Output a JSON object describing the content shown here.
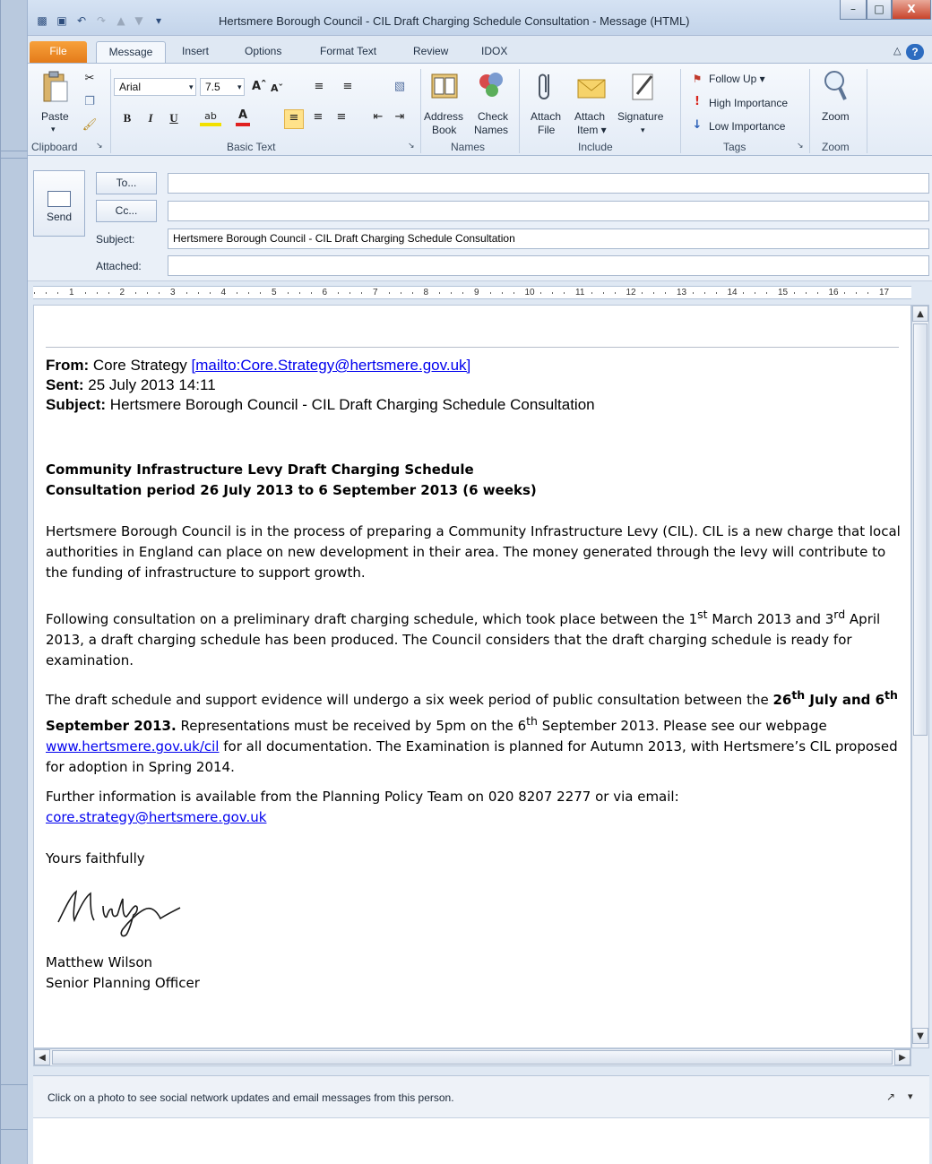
{
  "window": {
    "title": "Hertsmere Borough Council - CIL Draft Charging Schedule Consultation - Message (HTML)",
    "minimize": "–",
    "maximize": "□",
    "close": "X"
  },
  "tabs": [
    "File",
    "Message",
    "Insert",
    "Options",
    "Format Text",
    "Review",
    "IDOX"
  ],
  "ribbon": {
    "clipboard": {
      "paste": "Paste",
      "label": "Clipboard"
    },
    "basic_text": {
      "font": "Arial",
      "size": "7.5",
      "bold": "B",
      "italic": "I",
      "underline": "U",
      "label": "Basic Text"
    },
    "names": {
      "address_book_1": "Address",
      "address_book_2": "Book",
      "check_names_1": "Check",
      "check_names_2": "Names",
      "label": "Names"
    },
    "include": {
      "attach_file_1": "Attach",
      "attach_file_2": "File",
      "attach_item_1": "Attach",
      "attach_item_2": "Item ▾",
      "signature": "Signature",
      "label": "Include"
    },
    "tags": {
      "follow_up": "Follow Up ▾",
      "high": "High Importance",
      "low": "Low Importance",
      "label": "Tags"
    },
    "zoom": {
      "button": "Zoom",
      "label": "Zoom"
    }
  },
  "header": {
    "send": "Send",
    "to": "To...",
    "cc": "Cc...",
    "subject_label": "Subject:",
    "subject_value": "Hertsmere Borough Council - CIL Draft Charging Schedule Consultation",
    "attached_label": "Attached:"
  },
  "ruler": [
    "1",
    "2",
    "3",
    "4",
    "5",
    "6",
    "7",
    "8",
    "9",
    "10",
    "11",
    "12",
    "13",
    "14",
    "15",
    "16",
    "17"
  ],
  "email": {
    "from_label": "From:",
    "from_name": "Core Strategy",
    "from_link": "[mailto:Core.Strategy@hertsmere.gov.uk]",
    "sent_label": "Sent:",
    "sent_value": "25 July 2013 14:11",
    "subject_label": "Subject:",
    "subject_value": "Hertsmere Borough Council - CIL Draft Charging Schedule Consultation",
    "heading_1": "Community Infrastructure Levy Draft Charging Schedule",
    "heading_2": "Consultation period 26 July 2013 to 6 September 2013 (6 weeks)",
    "para_1": "Hertsmere Borough Council is in the process of preparing a Community Infrastructure Levy (CIL).  CIL is a new charge that local authorities in England can place on new development in their area. The money generated through the levy will contribute to the funding of infrastructure to support growth.",
    "para_2a": "Following consultation on a preliminary draft charging schedule, which took place between the  1",
    "para_2_sup1": "st",
    "para_2b": " March 2013 and 3",
    "para_2_sup2": "rd",
    "para_2c": " April 2013, a draft charging schedule has been produced.  The Council considers that the draft charging schedule is ready for examination.",
    "para_3a": "The draft schedule and support evidence will undergo a six week period of public consultation between the ",
    "para_3_b1": "26",
    "para_3_sup1": "th",
    "para_3_b2": " July and 6",
    "para_3_sup2": "th",
    "para_3_b3": " September 2013.",
    "para_3b": " Representations must be received by 5pm on the 6",
    "para_3_sup3": "th",
    "para_3c": " September 2013.  Please see our webpage ",
    "para_3_link": "www.hertsmere.gov.uk/cil",
    "para_3d": "  for all documentation.  The Examination is planned for Autumn 2013, with Hertsmere’s CIL proposed for adoption in Spring 2014.",
    "para_4": "Further information is available from the Planning Policy Team on 020 8207 2277 or via email:",
    "para_4_link": "core.strategy@hertsmere.gov.uk",
    "closing": "Yours faithfully",
    "signature_text": "M Wilson",
    "name": "Matthew Wilson",
    "role": "Senior Planning Officer"
  },
  "people_pane": {
    "text": "Click on a photo to see social network updates and email messages from this person."
  }
}
